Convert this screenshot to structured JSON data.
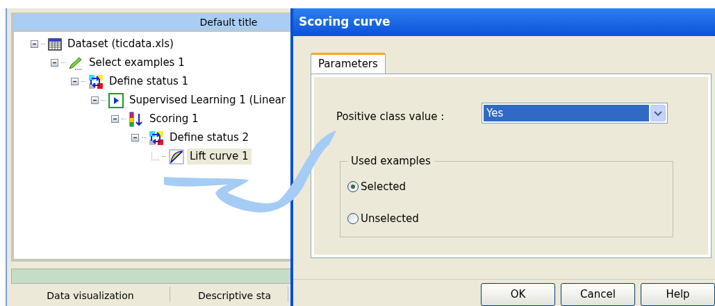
{
  "main_panel": {
    "title": "Default title",
    "tree": [
      {
        "label": "Dataset (ticdata.xls)",
        "kind": "dataset",
        "expanded": true,
        "selected": false,
        "children": [
          {
            "label": "Select examples 1",
            "kind": "select",
            "expanded": true,
            "selected": false,
            "children": [
              {
                "label": "Define status 1",
                "kind": "status",
                "expanded": true,
                "selected": false,
                "children": [
                  {
                    "label": "Supervised Learning 1 (Linear",
                    "kind": "learning",
                    "expanded": true,
                    "selected": false,
                    "children": [
                      {
                        "label": "Scoring 1",
                        "kind": "scoring",
                        "expanded": true,
                        "selected": false,
                        "children": [
                          {
                            "label": "Define status 2",
                            "kind": "status",
                            "expanded": true,
                            "selected": false,
                            "children": [
                              {
                                "label": "Lift curve 1",
                                "kind": "curve",
                                "selected": true
                              }
                            ]
                          }
                        ]
                      }
                    ]
                  }
                ]
              }
            ]
          }
        ]
      }
    ],
    "bottom_tabs": [
      "Data visualization",
      "Descriptive sta"
    ]
  },
  "dialog": {
    "title": "Scoring curve",
    "tabs": [
      {
        "label": "Parameters",
        "selected": true
      }
    ],
    "positive_class": {
      "label": "Positive class value :",
      "value": "Yes"
    },
    "used_examples": {
      "title": "Used examples",
      "options": [
        {
          "label": "Selected",
          "selected": true
        },
        {
          "label": "Unselected",
          "selected": false
        }
      ]
    },
    "buttons": [
      "OK",
      "Cancel",
      "Help"
    ]
  }
}
